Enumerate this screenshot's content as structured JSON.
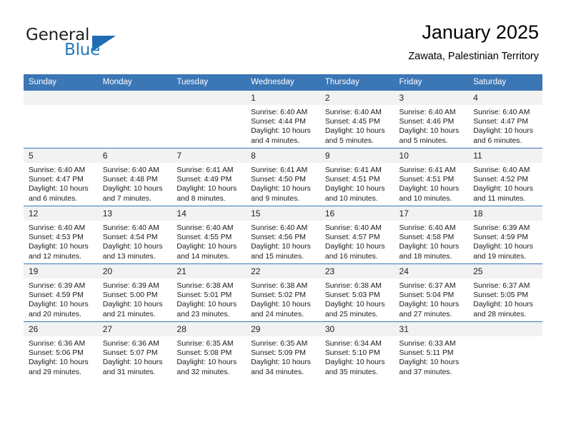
{
  "brand": {
    "name_top": "General",
    "name_bottom": "Blue",
    "accent_color": "#2279bd",
    "triangle_color": "#1f6cb4"
  },
  "header": {
    "title": "January 2025",
    "subtitle": "Zawata, Palestinian Territory"
  },
  "theme": {
    "header_row_bg": "#3b76b5",
    "daynum_bg": "#f2f2f2",
    "text_color": "#1a1a1a"
  },
  "labels": {
    "sunrise_prefix": "Sunrise:",
    "sunset_prefix": "Sunset:",
    "daylight_prefix": "Daylight:"
  },
  "weekday_headers": [
    "Sunday",
    "Monday",
    "Tuesday",
    "Wednesday",
    "Thursday",
    "Friday",
    "Saturday"
  ],
  "weeks": [
    [
      {
        "day": "",
        "sunrise": "",
        "sunset": "",
        "daylight_line1": "",
        "daylight_line2": ""
      },
      {
        "day": "",
        "sunrise": "",
        "sunset": "",
        "daylight_line1": "",
        "daylight_line2": ""
      },
      {
        "day": "",
        "sunrise": "",
        "sunset": "",
        "daylight_line1": "",
        "daylight_line2": ""
      },
      {
        "day": "1",
        "sunrise": "Sunrise: 6:40 AM",
        "sunset": "Sunset: 4:44 PM",
        "daylight_line1": "Daylight: 10 hours",
        "daylight_line2": "and 4 minutes."
      },
      {
        "day": "2",
        "sunrise": "Sunrise: 6:40 AM",
        "sunset": "Sunset: 4:45 PM",
        "daylight_line1": "Daylight: 10 hours",
        "daylight_line2": "and 5 minutes."
      },
      {
        "day": "3",
        "sunrise": "Sunrise: 6:40 AM",
        "sunset": "Sunset: 4:46 PM",
        "daylight_line1": "Daylight: 10 hours",
        "daylight_line2": "and 5 minutes."
      },
      {
        "day": "4",
        "sunrise": "Sunrise: 6:40 AM",
        "sunset": "Sunset: 4:47 PM",
        "daylight_line1": "Daylight: 10 hours",
        "daylight_line2": "and 6 minutes."
      }
    ],
    [
      {
        "day": "5",
        "sunrise": "Sunrise: 6:40 AM",
        "sunset": "Sunset: 4:47 PM",
        "daylight_line1": "Daylight: 10 hours",
        "daylight_line2": "and 6 minutes."
      },
      {
        "day": "6",
        "sunrise": "Sunrise: 6:40 AM",
        "sunset": "Sunset: 4:48 PM",
        "daylight_line1": "Daylight: 10 hours",
        "daylight_line2": "and 7 minutes."
      },
      {
        "day": "7",
        "sunrise": "Sunrise: 6:41 AM",
        "sunset": "Sunset: 4:49 PM",
        "daylight_line1": "Daylight: 10 hours",
        "daylight_line2": "and 8 minutes."
      },
      {
        "day": "8",
        "sunrise": "Sunrise: 6:41 AM",
        "sunset": "Sunset: 4:50 PM",
        "daylight_line1": "Daylight: 10 hours",
        "daylight_line2": "and 9 minutes."
      },
      {
        "day": "9",
        "sunrise": "Sunrise: 6:41 AM",
        "sunset": "Sunset: 4:51 PM",
        "daylight_line1": "Daylight: 10 hours",
        "daylight_line2": "and 10 minutes."
      },
      {
        "day": "10",
        "sunrise": "Sunrise: 6:41 AM",
        "sunset": "Sunset: 4:51 PM",
        "daylight_line1": "Daylight: 10 hours",
        "daylight_line2": "and 10 minutes."
      },
      {
        "day": "11",
        "sunrise": "Sunrise: 6:40 AM",
        "sunset": "Sunset: 4:52 PM",
        "daylight_line1": "Daylight: 10 hours",
        "daylight_line2": "and 11 minutes."
      }
    ],
    [
      {
        "day": "12",
        "sunrise": "Sunrise: 6:40 AM",
        "sunset": "Sunset: 4:53 PM",
        "daylight_line1": "Daylight: 10 hours",
        "daylight_line2": "and 12 minutes."
      },
      {
        "day": "13",
        "sunrise": "Sunrise: 6:40 AM",
        "sunset": "Sunset: 4:54 PM",
        "daylight_line1": "Daylight: 10 hours",
        "daylight_line2": "and 13 minutes."
      },
      {
        "day": "14",
        "sunrise": "Sunrise: 6:40 AM",
        "sunset": "Sunset: 4:55 PM",
        "daylight_line1": "Daylight: 10 hours",
        "daylight_line2": "and 14 minutes."
      },
      {
        "day": "15",
        "sunrise": "Sunrise: 6:40 AM",
        "sunset": "Sunset: 4:56 PM",
        "daylight_line1": "Daylight: 10 hours",
        "daylight_line2": "and 15 minutes."
      },
      {
        "day": "16",
        "sunrise": "Sunrise: 6:40 AM",
        "sunset": "Sunset: 4:57 PM",
        "daylight_line1": "Daylight: 10 hours",
        "daylight_line2": "and 16 minutes."
      },
      {
        "day": "17",
        "sunrise": "Sunrise: 6:40 AM",
        "sunset": "Sunset: 4:58 PM",
        "daylight_line1": "Daylight: 10 hours",
        "daylight_line2": "and 18 minutes."
      },
      {
        "day": "18",
        "sunrise": "Sunrise: 6:39 AM",
        "sunset": "Sunset: 4:59 PM",
        "daylight_line1": "Daylight: 10 hours",
        "daylight_line2": "and 19 minutes."
      }
    ],
    [
      {
        "day": "19",
        "sunrise": "Sunrise: 6:39 AM",
        "sunset": "Sunset: 4:59 PM",
        "daylight_line1": "Daylight: 10 hours",
        "daylight_line2": "and 20 minutes."
      },
      {
        "day": "20",
        "sunrise": "Sunrise: 6:39 AM",
        "sunset": "Sunset: 5:00 PM",
        "daylight_line1": "Daylight: 10 hours",
        "daylight_line2": "and 21 minutes."
      },
      {
        "day": "21",
        "sunrise": "Sunrise: 6:38 AM",
        "sunset": "Sunset: 5:01 PM",
        "daylight_line1": "Daylight: 10 hours",
        "daylight_line2": "and 23 minutes."
      },
      {
        "day": "22",
        "sunrise": "Sunrise: 6:38 AM",
        "sunset": "Sunset: 5:02 PM",
        "daylight_line1": "Daylight: 10 hours",
        "daylight_line2": "and 24 minutes."
      },
      {
        "day": "23",
        "sunrise": "Sunrise: 6:38 AM",
        "sunset": "Sunset: 5:03 PM",
        "daylight_line1": "Daylight: 10 hours",
        "daylight_line2": "and 25 minutes."
      },
      {
        "day": "24",
        "sunrise": "Sunrise: 6:37 AM",
        "sunset": "Sunset: 5:04 PM",
        "daylight_line1": "Daylight: 10 hours",
        "daylight_line2": "and 27 minutes."
      },
      {
        "day": "25",
        "sunrise": "Sunrise: 6:37 AM",
        "sunset": "Sunset: 5:05 PM",
        "daylight_line1": "Daylight: 10 hours",
        "daylight_line2": "and 28 minutes."
      }
    ],
    [
      {
        "day": "26",
        "sunrise": "Sunrise: 6:36 AM",
        "sunset": "Sunset: 5:06 PM",
        "daylight_line1": "Daylight: 10 hours",
        "daylight_line2": "and 29 minutes."
      },
      {
        "day": "27",
        "sunrise": "Sunrise: 6:36 AM",
        "sunset": "Sunset: 5:07 PM",
        "daylight_line1": "Daylight: 10 hours",
        "daylight_line2": "and 31 minutes."
      },
      {
        "day": "28",
        "sunrise": "Sunrise: 6:35 AM",
        "sunset": "Sunset: 5:08 PM",
        "daylight_line1": "Daylight: 10 hours",
        "daylight_line2": "and 32 minutes."
      },
      {
        "day": "29",
        "sunrise": "Sunrise: 6:35 AM",
        "sunset": "Sunset: 5:09 PM",
        "daylight_line1": "Daylight: 10 hours",
        "daylight_line2": "and 34 minutes."
      },
      {
        "day": "30",
        "sunrise": "Sunrise: 6:34 AM",
        "sunset": "Sunset: 5:10 PM",
        "daylight_line1": "Daylight: 10 hours",
        "daylight_line2": "and 35 minutes."
      },
      {
        "day": "31",
        "sunrise": "Sunrise: 6:33 AM",
        "sunset": "Sunset: 5:11 PM",
        "daylight_line1": "Daylight: 10 hours",
        "daylight_line2": "and 37 minutes."
      },
      {
        "day": "",
        "sunrise": "",
        "sunset": "",
        "daylight_line1": "",
        "daylight_line2": ""
      }
    ]
  ]
}
